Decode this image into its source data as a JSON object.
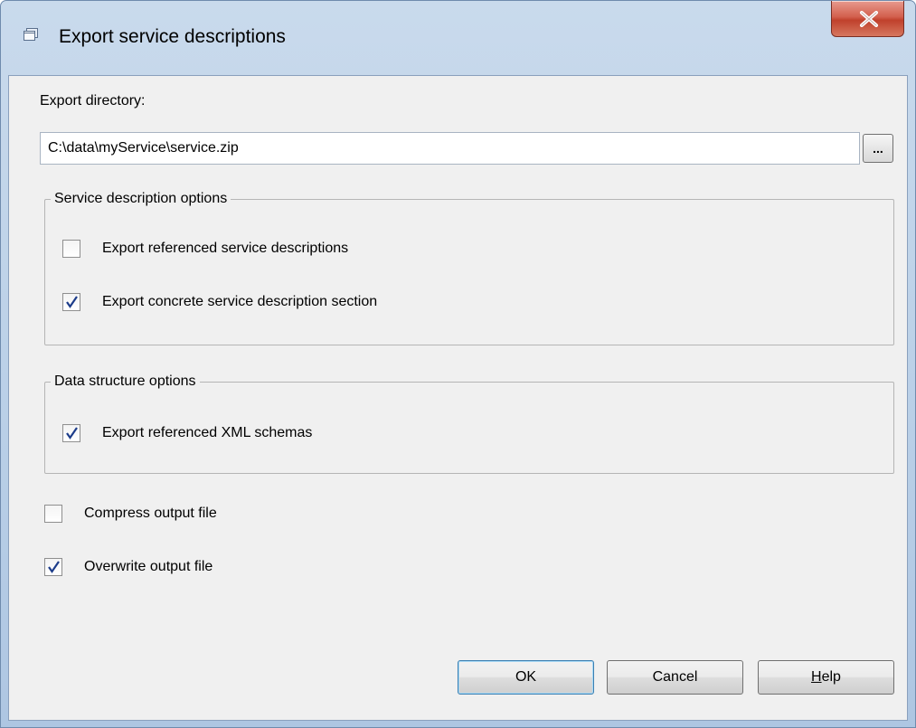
{
  "window": {
    "title": "Export service descriptions",
    "close_label": "X"
  },
  "export_directory": {
    "label": "Export directory:",
    "value": "C:\\data\\myService\\service.zip",
    "browse_label": "..."
  },
  "service_group": {
    "title": "Service description options",
    "options": [
      {
        "label": "Export referenced service descriptions",
        "checked": false
      },
      {
        "label": "Export concrete service description section",
        "checked": true
      }
    ]
  },
  "data_group": {
    "title": "Data structure options",
    "options": [
      {
        "label": "Export referenced XML schemas",
        "checked": true
      }
    ]
  },
  "output_options": [
    {
      "label": "Compress output file",
      "checked": false
    },
    {
      "label": "Overwrite output file",
      "checked": true
    }
  ],
  "buttons": {
    "ok": "OK",
    "cancel": "Cancel",
    "help_mnemonic": "H",
    "help_rest": "elp"
  },
  "colors": {
    "title_bar": "#b9cfe7",
    "client_bg": "#f0f0f0",
    "close_button": "#c0412c",
    "default_button_border": "#3c7fb1"
  },
  "icons": {
    "title": "window-app-icon",
    "close": "close-x-icon",
    "check": "checkmark-icon"
  }
}
